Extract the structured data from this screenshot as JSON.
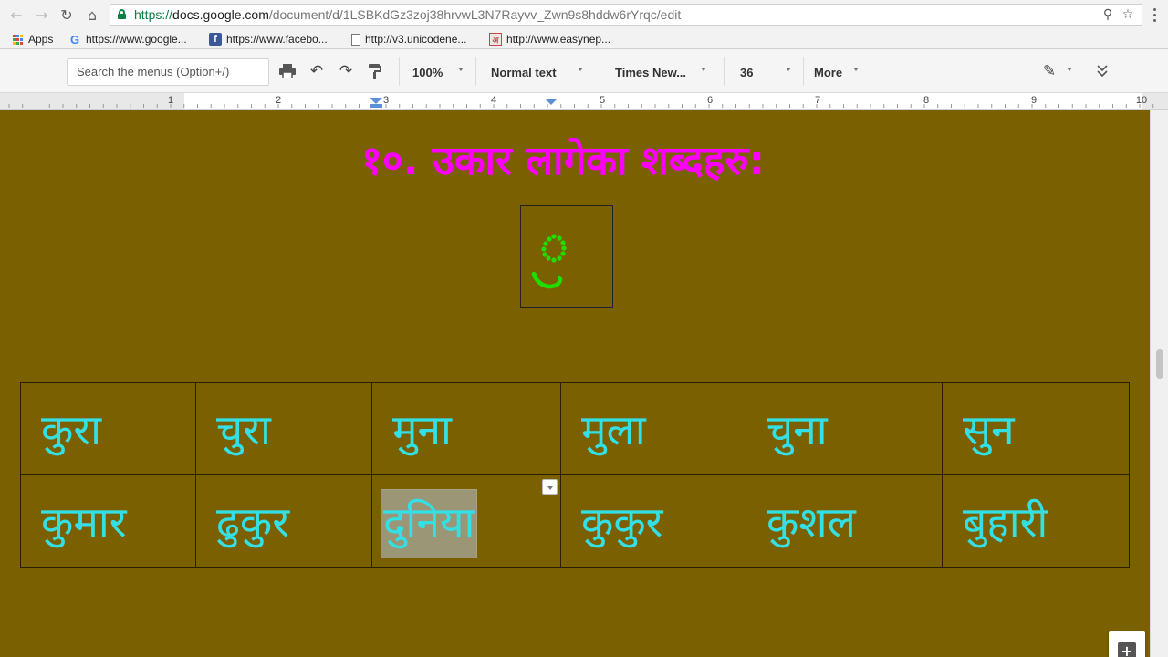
{
  "browser": {
    "url_scheme": "https://",
    "url_host": "docs.google.com",
    "url_path": "/document/d/1LSBKdGz3zoj38hrvwL3N7Rayvv_Zwn9s8hddw6rYrqc/edit"
  },
  "bookmarks": [
    {
      "label": "Apps",
      "icon": "apps-grid-icon"
    },
    {
      "label": "https://www.google...",
      "icon": "google-icon"
    },
    {
      "label": "https://www.facebo...",
      "icon": "facebook-icon"
    },
    {
      "label": "http://v3.unicodene...",
      "icon": "page-icon"
    },
    {
      "label": "http://www.easynep...",
      "icon": "devanagari-a-icon",
      "glyph": "अ"
    }
  ],
  "toolbar": {
    "search_placeholder": "Search the menus (Option+/)",
    "zoom": "100%",
    "style": "Normal text",
    "font": "Times New...",
    "font_size": "36",
    "more_label": "More"
  },
  "ruler": {
    "numbers": [
      "1",
      "2",
      "3",
      "4",
      "5",
      "6",
      "7",
      "8",
      "9",
      "10"
    ]
  },
  "document": {
    "heading": "१०. उकार लागेका शब्दहरु:",
    "letter_glyph": "उ",
    "words": [
      [
        "कुरा",
        "चुरा",
        "मुना",
        "मुला",
        "चुना",
        "सुन"
      ],
      [
        "कुमार",
        "ढुकुर",
        "दुनिया",
        "कुकुर",
        "कुशल",
        "बुहारी"
      ]
    ],
    "selected_word": "दुनिया"
  },
  "colors": {
    "page_background": "#7b6000",
    "heading": "#ff00ff",
    "word_text": "#33e0e6",
    "letter_dots": "#22dd00",
    "selection": "#9a9676"
  }
}
